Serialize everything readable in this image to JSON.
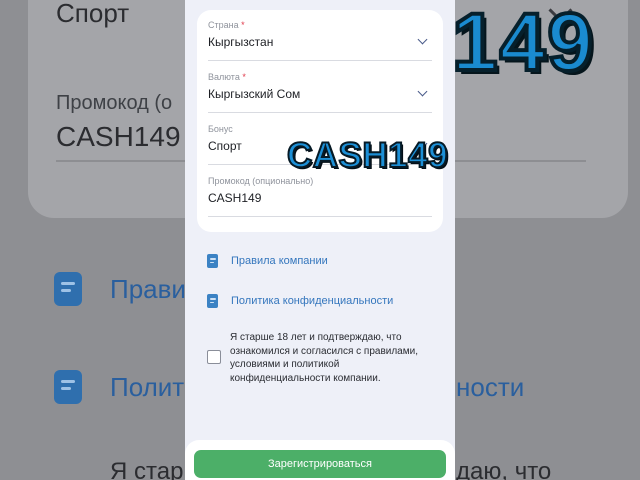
{
  "background": {
    "bonus_value": "Спорт",
    "promo_label": "Промокод (о",
    "promo_value": "CASH149",
    "rules_link": "Прави",
    "privacy_link": "Полит",
    "privacy_link_tail": "ности",
    "age_text": "Я стар",
    "age_text_tail": "даю, что"
  },
  "form": {
    "country": {
      "label": "Страна",
      "required_mark": "*",
      "value": "Кыргызстан"
    },
    "currency": {
      "label": "Валюта",
      "required_mark": "*",
      "value": "Кыргызский Сом"
    },
    "bonus": {
      "label": "Бонус",
      "value": "Спорт"
    },
    "promo": {
      "label": "Промокод (опционально)",
      "value": "CASH149"
    }
  },
  "links": {
    "rules": "Правила компании",
    "privacy": "Политика конфиденциальности"
  },
  "agreement": {
    "text": "Я старше 18 лет и подтверждаю, что ознакомился и согласился с правилами, условиями и политикой конфиденциальности компании.",
    "checked": false
  },
  "register_button": "Зарегистрироваться",
  "overlay": {
    "code": "CASH149",
    "big_digits": "149"
  },
  "colors": {
    "accent_green": "#4caf68",
    "link_blue": "#3476bd",
    "required_red": "#e0394a",
    "overlay_blue": "#1c8fd6"
  },
  "icons": [
    "chevron-down-icon",
    "document-icon"
  ]
}
